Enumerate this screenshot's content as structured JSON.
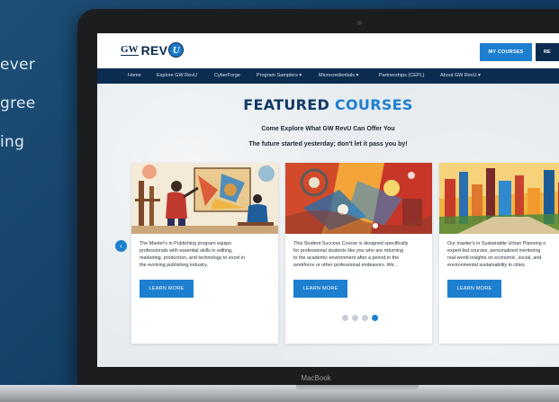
{
  "background": {
    "text_lines": [
      "ever",
      "gree",
      "ing"
    ]
  },
  "laptop": {
    "label": "MacBook"
  },
  "header": {
    "logo_gw": "GW",
    "logo_rev": "REV",
    "logo_u": "U",
    "my_courses_label": "MY COURSES",
    "second_button_label": "RE"
  },
  "nav": {
    "items": [
      "Home",
      "Explore GW RevU",
      "CyberForge",
      "Program Samplers ▾",
      "Microcredentials ▾",
      "Partnerships (CEPL)",
      "About GW RevU ▾"
    ]
  },
  "hero": {
    "title_part1": "FEATURED",
    "title_part2": "COURSES",
    "subtitle": "Come Explore What GW RevU Can Offer You",
    "tagline": "The future started yesterday; don't let it pass you by!"
  },
  "carousel": {
    "prev_arrow": "‹",
    "cards": [
      {
        "lines": [
          "The Master's in Publishing program equips",
          "professionals with essential skills in editing,",
          "marketing, production, and technology to excel in",
          "the evolving publishing industry."
        ],
        "button": "LEARN MORE"
      },
      {
        "lines": [
          "This Student Success Course is designed specifically",
          "for professional students like you who are returning",
          "to the academic environment after a period in the",
          "workforce or other professional endeavors. We..."
        ],
        "button": "LEARN MORE"
      },
      {
        "lines": [
          "Our master's in Sustainable Urban Planning o",
          "expert-led courses, personalized mentoring",
          "real-world insights on economic, social, and",
          "environmental sustainability in cities."
        ],
        "button": "LEARN MORE"
      }
    ],
    "dots_count": 4,
    "active_dot": 3
  },
  "colors": {
    "navy": "#0b2c4f",
    "accent_blue": "#1d7fd0",
    "page_background": "#1e4f77"
  }
}
